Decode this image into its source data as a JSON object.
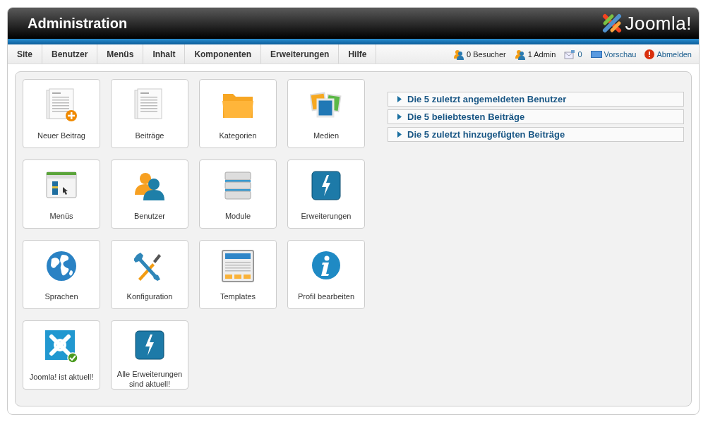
{
  "header": {
    "title": "Administration",
    "logo_text": "Joomla!"
  },
  "menu": [
    "Site",
    "Benutzer",
    "Menüs",
    "Inhalt",
    "Komponenten",
    "Erweiterungen",
    "Hilfe"
  ],
  "status": [
    {
      "kind": "text",
      "text": "0 Besucher"
    },
    {
      "kind": "text",
      "text": "1 Admin"
    },
    {
      "kind": "text",
      "text": "0"
    },
    {
      "kind": "link",
      "text": "Vorschau"
    },
    {
      "kind": "link",
      "text": "Abmelden"
    }
  ],
  "tiles": [
    {
      "label": "Neuer Beitrag"
    },
    {
      "label": "Beiträge"
    },
    {
      "label": "Kategorien"
    },
    {
      "label": "Medien"
    },
    {
      "label": "Menüs"
    },
    {
      "label": "Benutzer"
    },
    {
      "label": "Module"
    },
    {
      "label": "Erweiterungen"
    },
    {
      "label": "Sprachen"
    },
    {
      "label": "Konfiguration"
    },
    {
      "label": "Templates"
    },
    {
      "label": "Profil bearbeiten"
    },
    {
      "label": "Joomla! ist aktuell!"
    },
    {
      "label": "Alle Erweiterungen sind aktuell!"
    }
  ],
  "modules": [
    {
      "title": "Die 5 zuletzt angemeldeten Benutzer",
      "expanded": false
    },
    {
      "title": "Die 5 beliebtesten Beiträge",
      "expanded": false
    },
    {
      "title": "Die 5 zuletzt hinzugefügten Beiträge",
      "expanded": false
    }
  ]
}
